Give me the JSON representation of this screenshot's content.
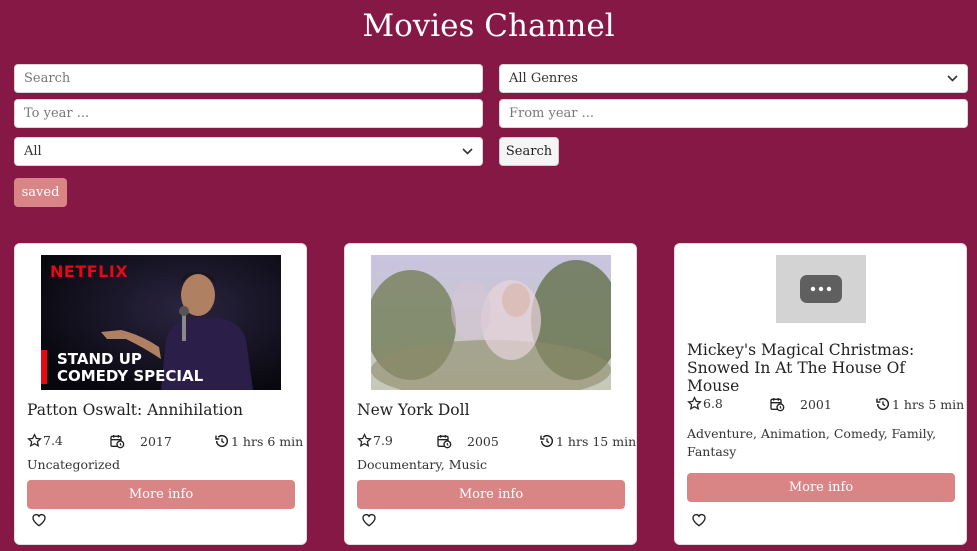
{
  "header": {
    "title": "Movies Channel"
  },
  "filters": {
    "search_placeholder": "Search",
    "genre_selected": "All Genres",
    "to_year_placeholder": "To year ...",
    "from_year_placeholder": "From year ...",
    "type_selected": "All",
    "search_button": "Search",
    "saved_button": "saved"
  },
  "cards": [
    {
      "title": "Patton Oswalt: Annihilation",
      "rating": "7.4",
      "year": "2017",
      "duration": "1 hrs 6 min",
      "genres": "Uncategorized",
      "more_label": "More info",
      "thumb_brand": "NETFLIX",
      "thumb_line1": "STAND UP",
      "thumb_line2": "COMEDY SPECIAL"
    },
    {
      "title": "New York Doll",
      "rating": "7.9",
      "year": "2005",
      "duration": "1 hrs 15 min",
      "genres": "Documentary, Music",
      "more_label": "More info"
    },
    {
      "title": "Mickey's Magical Christmas: Snowed In At The House Of Mouse",
      "rating": "6.8",
      "year": "2001",
      "duration": "1 hrs 5 min",
      "genres": "Adventure, Animation, Comedy, Family, Fantasy",
      "more_label": "More info"
    }
  ],
  "colors": {
    "background": "#861845",
    "accent": "#d98585",
    "netflix_red": "#e50914"
  },
  "icons": [
    "chevron-down-icon",
    "star-icon",
    "calendar-clock-icon",
    "history-icon",
    "heart-icon",
    "ellipsis-icon"
  ]
}
